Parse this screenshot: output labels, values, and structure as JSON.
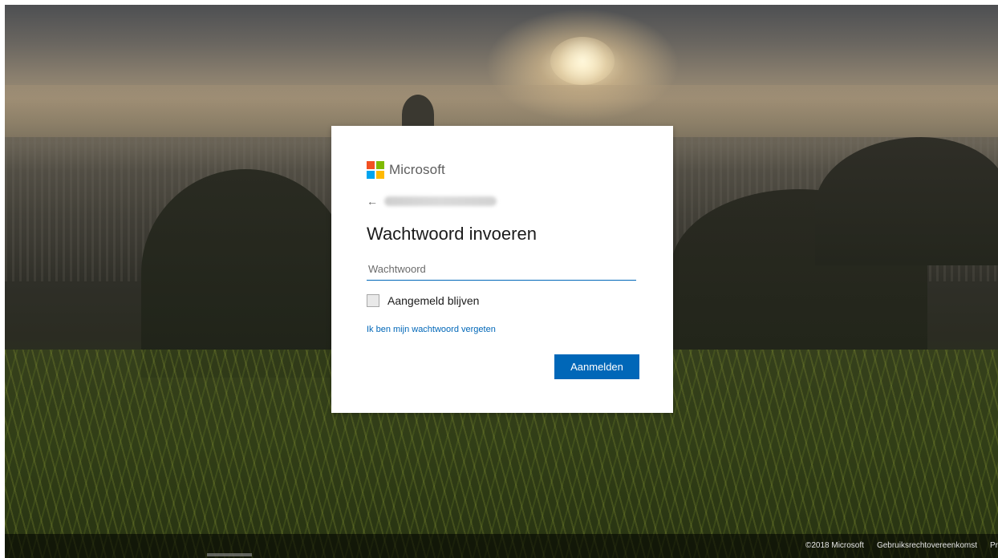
{
  "brand": {
    "name": "Microsoft",
    "logo_colors": [
      "#f25022",
      "#7fba00",
      "#00a4ef",
      "#ffb900"
    ]
  },
  "dialog": {
    "back_icon": "back-arrow-icon",
    "back_glyph": "←",
    "title": "Wachtwoord invoeren",
    "password": {
      "placeholder": "Wachtwoord",
      "value": ""
    },
    "remember": {
      "label": "Aangemeld blijven",
      "checked": false
    },
    "forgot_link": "Ik ben mijn wachtwoord vergeten",
    "submit_label": "Aanmelden"
  },
  "footer": {
    "copyright": "©2018 Microsoft",
    "terms_link": "Gebruiksrechtovereenkomst",
    "privacy_link": "Pr"
  },
  "colors": {
    "accent": "#0067b8",
    "text": "#1b1b1b"
  }
}
